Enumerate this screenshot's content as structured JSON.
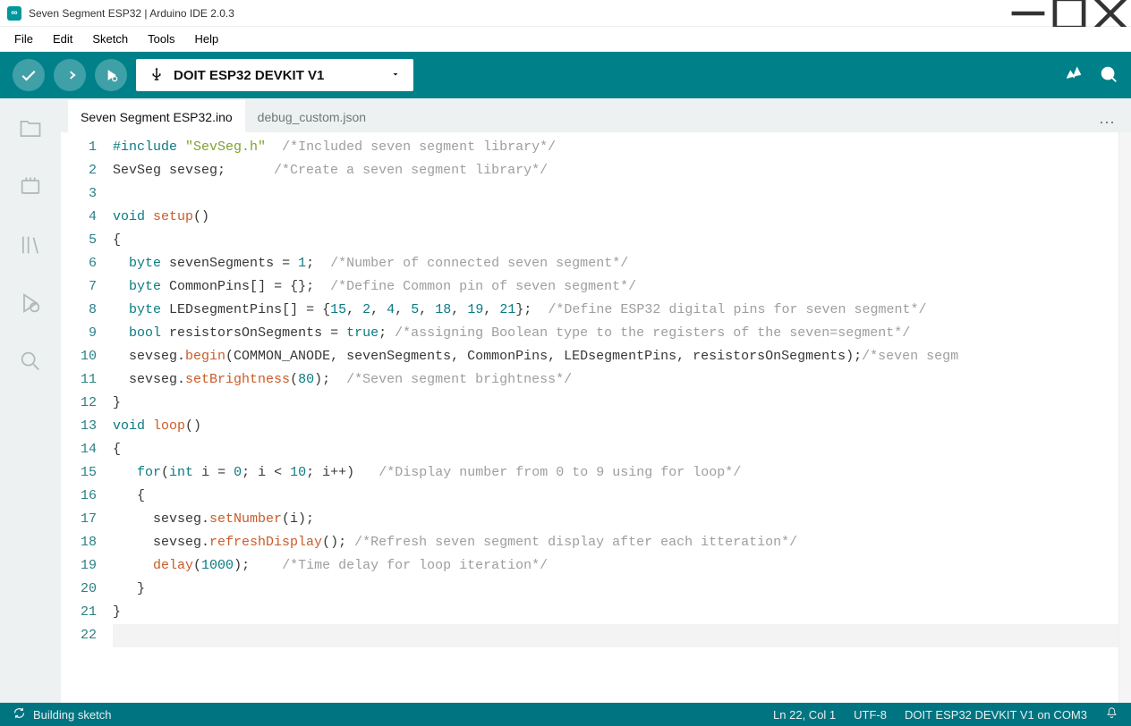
{
  "window": {
    "title": "Seven Segment ESP32 | Arduino IDE 2.0.3"
  },
  "menu": {
    "items": [
      "File",
      "Edit",
      "Sketch",
      "Tools",
      "Help"
    ]
  },
  "toolbar": {
    "board": "DOIT ESP32 DEVKIT V1"
  },
  "tabs": {
    "items": [
      {
        "label": "Seven Segment ESP32.ino",
        "active": true
      },
      {
        "label": "debug_custom.json",
        "active": false
      }
    ]
  },
  "status": {
    "building": "Building sketch",
    "cursor": "Ln 22, Col 1",
    "encoding": "UTF-8",
    "board": "DOIT ESP32 DEVKIT V1 on COM3"
  },
  "code": {
    "lines": [
      {
        "n": 1,
        "html": "<span class='kw'>#include</span> <span class='str'>\"SevSeg.h\"</span>  <span class='cm'>/*Included seven segment library*/</span>"
      },
      {
        "n": 2,
        "html": "<span class='plain'>SevSeg sevseg;</span>      <span class='cm'>/*Create a seven segment library*/</span>"
      },
      {
        "n": 3,
        "html": ""
      },
      {
        "n": 4,
        "html": "<span class='type'>void</span> <span class='fn'>setup</span><span class='plain'>()</span>"
      },
      {
        "n": 5,
        "html": "<span class='plain'>{</span>"
      },
      {
        "n": 6,
        "html": "  <span class='type'>byte</span> <span class='plain'>sevenSegments =</span> <span class='num'>1</span><span class='plain'>;</span>  <span class='cm'>/*Number of connected seven segment*/</span>"
      },
      {
        "n": 7,
        "html": "  <span class='type'>byte</span> <span class='plain'>CommonPins[] = {};</span>  <span class='cm'>/*Define Common pin of seven segment*/</span>"
      },
      {
        "n": 8,
        "html": "  <span class='type'>byte</span> <span class='plain'>LEDsegmentPins[] = {</span><span class='num'>15</span><span class='plain'>,</span> <span class='num'>2</span><span class='plain'>,</span> <span class='num'>4</span><span class='plain'>,</span> <span class='num'>5</span><span class='plain'>,</span> <span class='num'>18</span><span class='plain'>,</span> <span class='num'>19</span><span class='plain'>,</span> <span class='num'>21</span><span class='plain'>};</span>  <span class='cm'>/*Define ESP32 digital pins for seven segment*/</span>"
      },
      {
        "n": 9,
        "html": "  <span class='type'>bool</span> <span class='plain'>resistorsOnSegments =</span> <span class='bool'>true</span><span class='plain'>;</span> <span class='cm'>/*assigning Boolean type to the registers of the seven=segment*/</span>"
      },
      {
        "n": 10,
        "html": "  <span class='plain'>sevseg.</span><span class='fn'>begin</span><span class='plain'>(COMMON_ANODE, sevenSegments, CommonPins, LEDsegmentPins, resistorsOnSegments);</span><span class='cm'>/*seven segm</span>"
      },
      {
        "n": 11,
        "html": "  <span class='plain'>sevseg.</span><span class='fn'>setBrightness</span><span class='plain'>(</span><span class='num'>80</span><span class='plain'>);</span>  <span class='cm'>/*Seven segment brightness*/</span>"
      },
      {
        "n": 12,
        "html": "<span class='plain'>}</span>"
      },
      {
        "n": 13,
        "html": "<span class='type'>void</span> <span class='fn'>loop</span><span class='plain'>()</span>"
      },
      {
        "n": 14,
        "html": "<span class='plain'>{</span>"
      },
      {
        "n": 15,
        "html": "   <span class='kw'>for</span><span class='plain'>(</span><span class='type'>int</span> <span class='plain'>i =</span> <span class='num'>0</span><span class='plain'>; i <</span> <span class='num'>10</span><span class='plain'>; i++)</span>   <span class='cm'>/*Display number from 0 to 9 using for loop*/</span>"
      },
      {
        "n": 16,
        "html": "   <span class='plain'>{</span>"
      },
      {
        "n": 17,
        "html": "     <span class='plain'>sevseg.</span><span class='fn'>setNumber</span><span class='plain'>(i);</span>"
      },
      {
        "n": 18,
        "html": "     <span class='plain'>sevseg.</span><span class='fn'>refreshDisplay</span><span class='plain'>();</span> <span class='cm'>/*Refresh seven segment display after each itteration*/</span>"
      },
      {
        "n": 19,
        "html": "     <span class='fn'>delay</span><span class='plain'>(</span><span class='num'>1000</span><span class='plain'>);</span>    <span class='cm'>/*Time delay for loop iteration*/</span>"
      },
      {
        "n": 20,
        "html": "   <span class='plain'>}</span>"
      },
      {
        "n": 21,
        "html": "<span class='plain'>}</span>"
      },
      {
        "n": 22,
        "html": "",
        "current": true
      }
    ]
  }
}
